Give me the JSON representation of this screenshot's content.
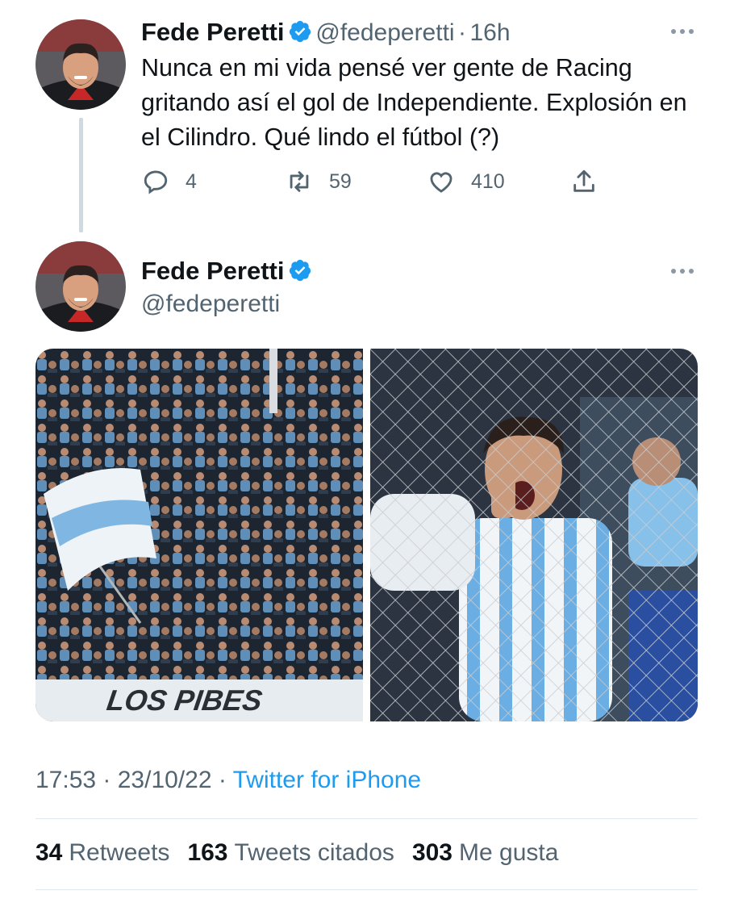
{
  "tweet1": {
    "author_name": "Fede Peretti",
    "author_handle": "@fedeperetti",
    "separator": "·",
    "time": "16h",
    "text": "Nunca en mi vida pensé ver gente de Racing gritando así el gol de Independiente. Explosión en el Cilindro. Qué lindo el fútbol (?)",
    "replies": "4",
    "retweets": "59",
    "likes": "410",
    "icons": [
      "reply-icon",
      "retweet-icon",
      "like-icon",
      "share-icon",
      "more-icon",
      "verified-icon"
    ]
  },
  "tweet2": {
    "author_name": "Fede Peretti",
    "author_handle": "@fedeperetti",
    "images": [
      {
        "banner_text": "LOS PIBES"
      },
      {}
    ],
    "timestamp": "17:53 · 23/10/22 · ",
    "source": "Twitter for iPhone",
    "stats": {
      "retweets_count": "34",
      "retweets_label": "Retweets",
      "quotes_count": "163",
      "quotes_label": "Tweets citados",
      "likes_count": "303",
      "likes_label": "Me gusta"
    }
  },
  "colors": {
    "accent": "#1d9bf0",
    "secondary_text": "#536471",
    "primary_text": "#0f1419",
    "thread_line": "#cfd9de"
  }
}
